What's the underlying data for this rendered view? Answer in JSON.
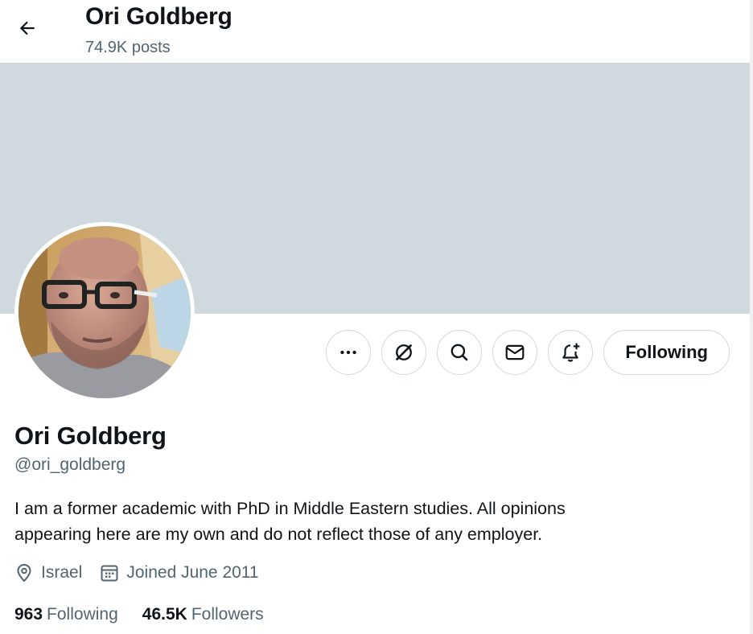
{
  "header": {
    "title": "Ori Goldberg",
    "posts_count": "74.9K posts"
  },
  "profile": {
    "name": "Ori Goldberg",
    "handle": "@ori_goldberg",
    "bio": "I am a former academic with  PhD in Middle Eastern studies. All opinions\nappearing here are my own and do not reflect those of any employer.",
    "location": "Israel",
    "joined": "Joined June 2011",
    "following_count": "963",
    "following_label": "Following",
    "followers_count": "46.5K",
    "followers_label": "Followers"
  },
  "actions": {
    "follow_button_label": "Following",
    "icons": [
      "more-icon",
      "grok-icon",
      "search-icon",
      "message-icon",
      "notification-bell-icon"
    ]
  },
  "colors": {
    "banner": "#cfd9de",
    "primary_text": "#0f1419",
    "secondary_text": "#536471",
    "button_border": "#cfd9de"
  }
}
